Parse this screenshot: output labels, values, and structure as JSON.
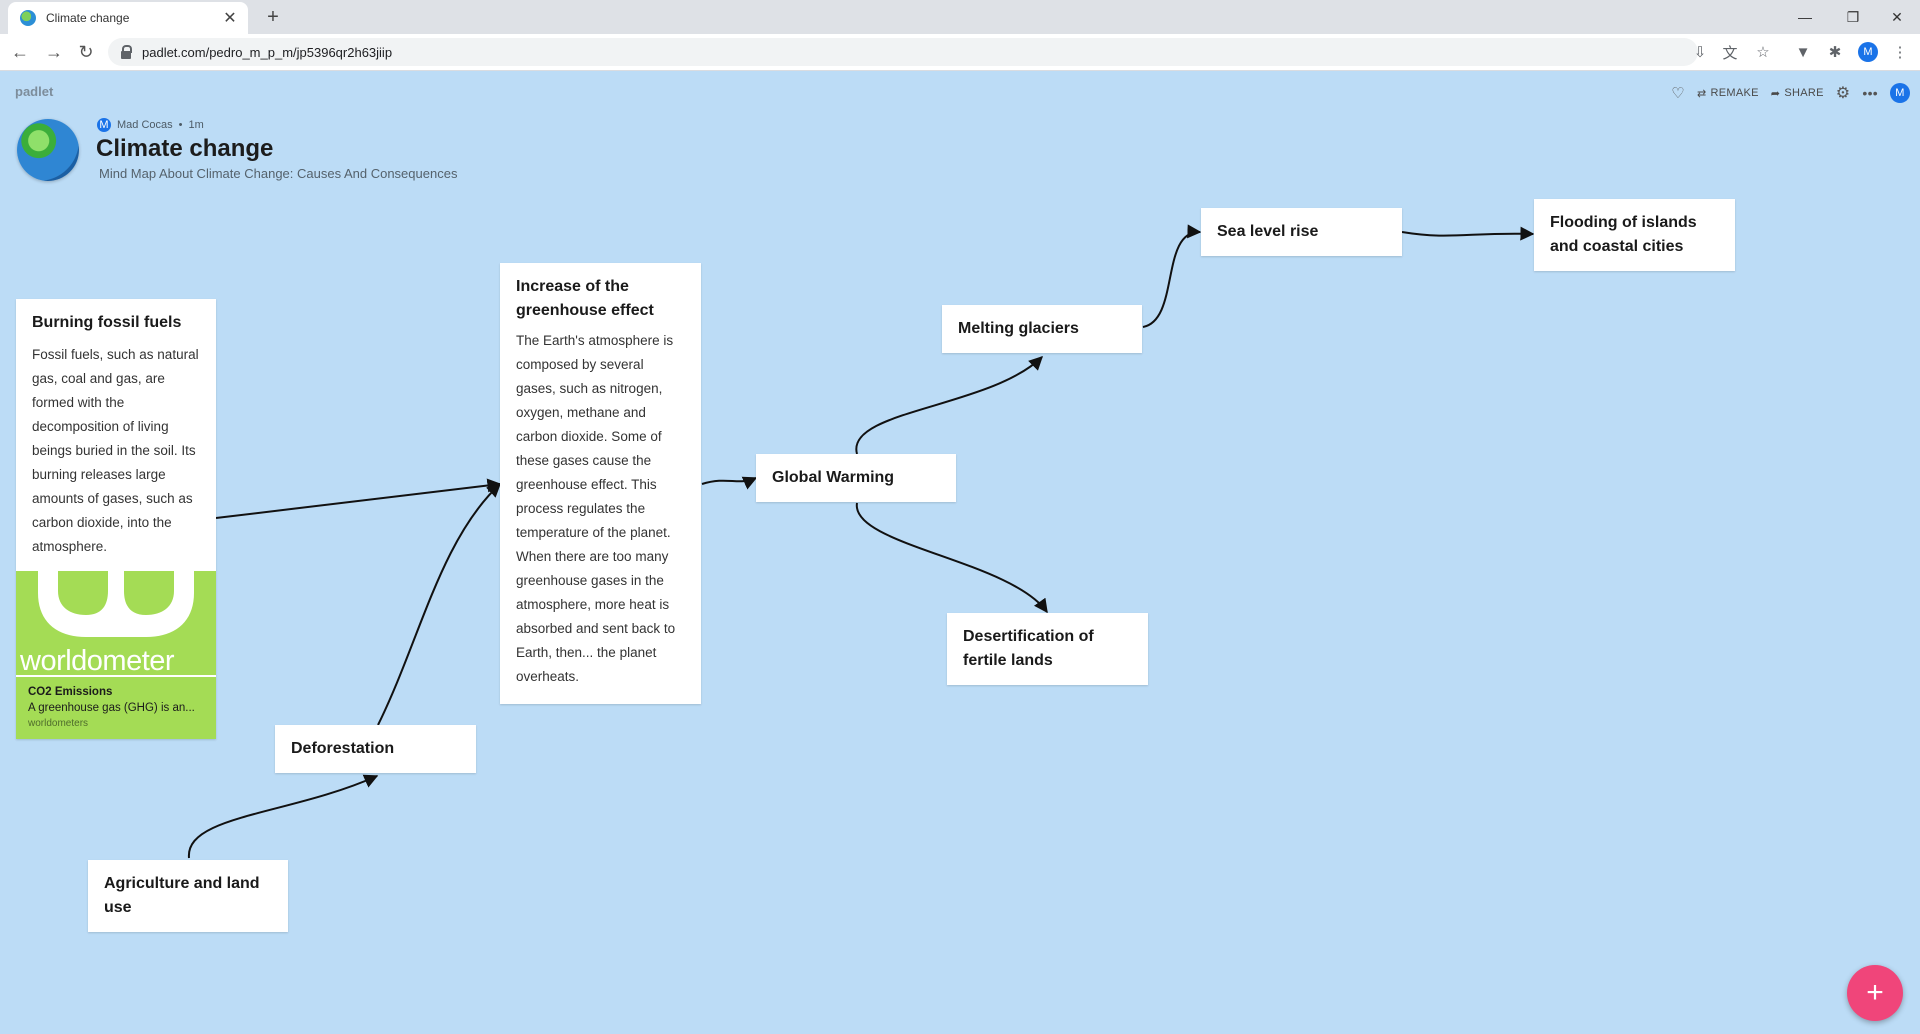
{
  "browser": {
    "tab_title": "Climate change",
    "url": "padlet.com/pedro_m_p_m/jp5396qr2h63jiip",
    "profile_initial": "M"
  },
  "padlet": {
    "logo": "padlet",
    "actions": {
      "remake": "REMAKE",
      "share": "SHARE",
      "avatar_initial": "M"
    },
    "author": "Mad Cocas",
    "author_initial": "M",
    "time": "1m",
    "title": "Climate change",
    "subtitle": "Mind Map About Climate Change: Causes And Consequences"
  },
  "posts": {
    "burning": {
      "title": "Burning fossil fuels",
      "body": "Fossil fuels, such as natural gas, coal and gas, are formed with the decomposition of living beings buried in the soil. Its burning releases large amounts of gases, such as carbon dioxide, into the atmosphere.",
      "attachment": {
        "logo_text": "worldometer",
        "title": "CO2 Emissions",
        "desc": "A greenhouse gas (GHG) is an...",
        "source": "worldometers"
      }
    },
    "greenhouse": {
      "title": "Increase of the greenhouse effect",
      "body": "The Earth's atmosphere is composed by several gases, such as nitrogen, oxygen, methane and carbon dioxide. Some of these gases cause the greenhouse effect. This process regulates the temperature of the planet. When there are too many greenhouse gases in the atmosphere, more heat is absorbed and sent back to Earth, then... the planet overheats."
    },
    "deforestation": {
      "title": "Deforestation"
    },
    "agriculture": {
      "title": "Agriculture and land use"
    },
    "global_warming": {
      "title": "Global Warming"
    },
    "melting": {
      "title": "Melting glaciers"
    },
    "sea_level": {
      "title": "Sea level rise"
    },
    "flooding": {
      "title": "Flooding of islands and coastal cities"
    },
    "desertification": {
      "title": "Desertification of fertile lands"
    }
  },
  "colors": {
    "background": "#bcdcf6",
    "fab": "#f0457a",
    "attachment": "#a4dc55"
  }
}
